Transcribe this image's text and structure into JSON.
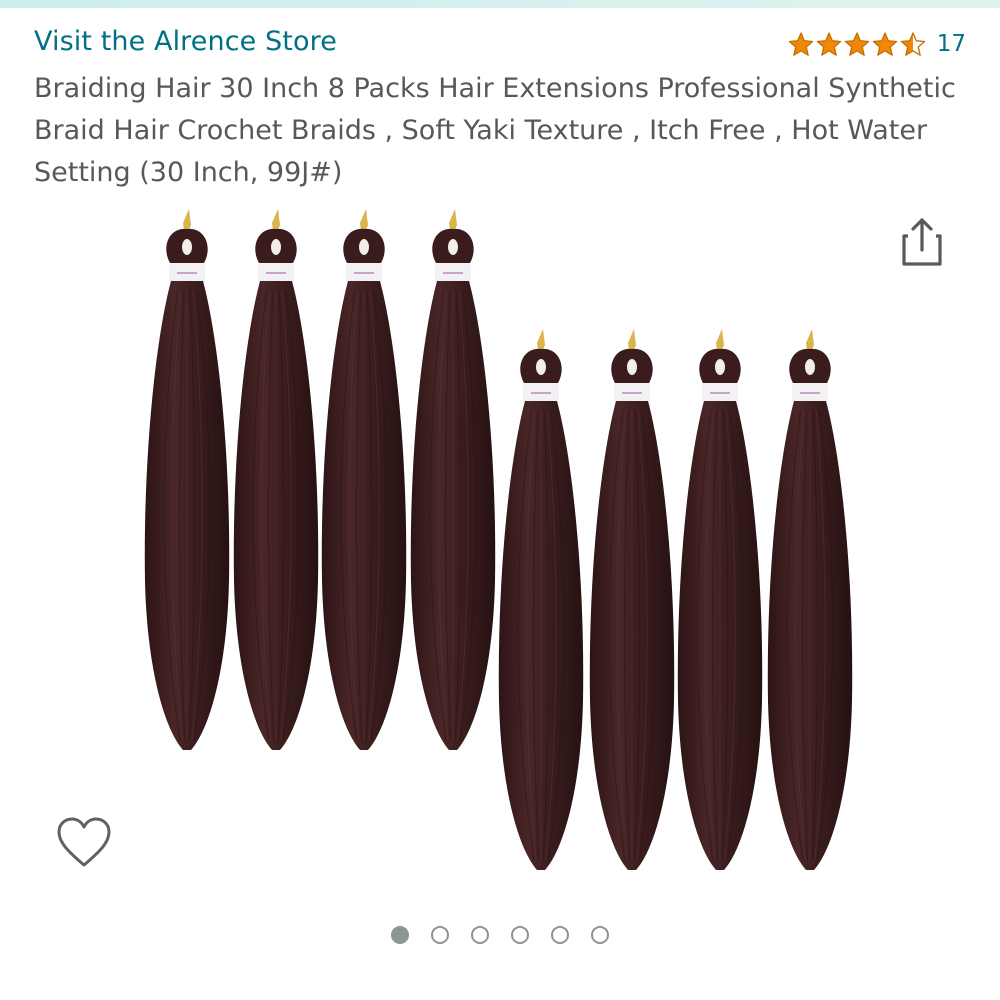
{
  "store": {
    "link_text": "Visit the Alrence Store",
    "color": "#007185"
  },
  "rating": {
    "stars": 4.5,
    "count": "17",
    "star_color": "#f08804"
  },
  "product": {
    "title": "Braiding Hair 30 Inch 8 Packs Hair Extensions Professional Synthetic Braid Hair Crochet Braids , Soft Yaki Texture , Itch Free , Hot Water Setting (30 Inch, 99J#)",
    "title_color": "#565959",
    "hair_color": "#3a1d1c"
  },
  "gallery": {
    "image_count": 6,
    "active_index": 0,
    "share_icon": "share-icon",
    "wishlist_icon": "heart-outline-icon"
  }
}
